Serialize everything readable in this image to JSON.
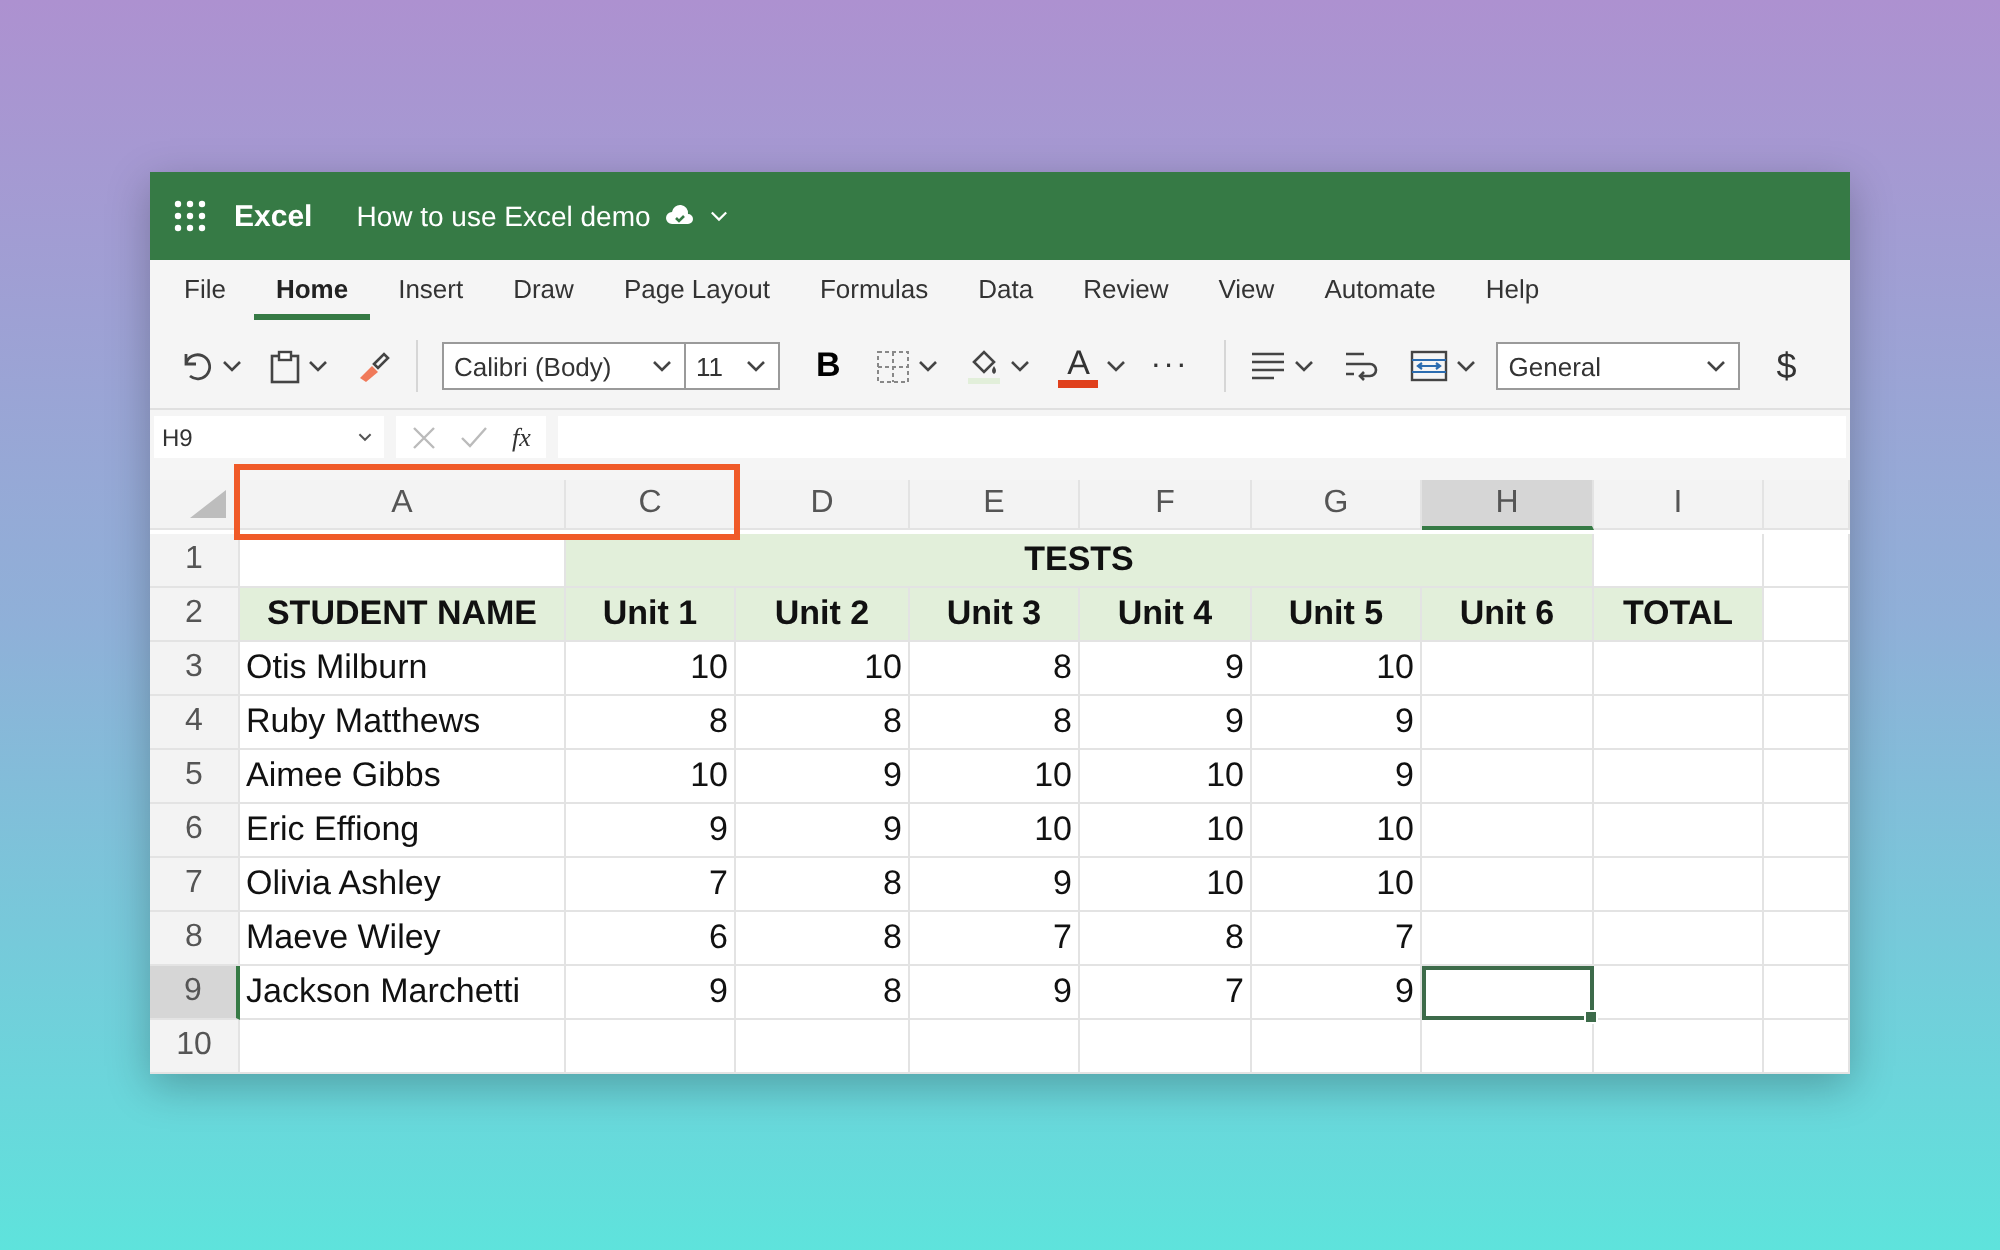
{
  "app": {
    "name": "Excel",
    "document_title": "How to use Excel demo"
  },
  "menu_tabs": [
    {
      "label": "File",
      "selected": false
    },
    {
      "label": "Home",
      "selected": true
    },
    {
      "label": "Insert",
      "selected": false
    },
    {
      "label": "Draw",
      "selected": false
    },
    {
      "label": "Page Layout",
      "selected": false
    },
    {
      "label": "Formulas",
      "selected": false
    },
    {
      "label": "Data",
      "selected": false
    },
    {
      "label": "Review",
      "selected": false
    },
    {
      "label": "View",
      "selected": false
    },
    {
      "label": "Automate",
      "selected": false
    },
    {
      "label": "Help",
      "selected": false
    }
  ],
  "toolbar": {
    "font": "Calibri (Body)",
    "font_size": "11",
    "bold": "B",
    "font_color": "A",
    "more": "···",
    "number_format": "General",
    "currency": "$"
  },
  "formula_bar": {
    "name_box": "H9",
    "function_label": "fx"
  },
  "sheet": {
    "columns": [
      {
        "label": "A",
        "selected": false,
        "highlighted": true
      },
      {
        "label": "C",
        "selected": false,
        "highlighted": true
      },
      {
        "label": "D",
        "selected": false,
        "highlighted": false
      },
      {
        "label": "E",
        "selected": false,
        "highlighted": false
      },
      {
        "label": "F",
        "selected": false,
        "highlighted": false
      },
      {
        "label": "G",
        "selected": false,
        "highlighted": false
      },
      {
        "label": "H",
        "selected": true,
        "highlighted": false
      },
      {
        "label": "I",
        "selected": false,
        "highlighted": false
      }
    ],
    "rows": [
      {
        "number": "1",
        "selected": false,
        "kind": "title",
        "title": "TESTS"
      },
      {
        "number": "2",
        "selected": false,
        "kind": "header",
        "cells": [
          "STUDENT NAME",
          "Unit 1",
          "Unit 2",
          "Unit 3",
          "Unit 4",
          "Unit 5",
          "Unit 6",
          "TOTAL"
        ]
      },
      {
        "number": "3",
        "selected": false,
        "kind": "data",
        "cells": [
          "Otis Milburn",
          "10",
          "10",
          "8",
          "9",
          "10"
        ]
      },
      {
        "number": "4",
        "selected": false,
        "kind": "data",
        "cells": [
          "Ruby Matthews",
          "8",
          "8",
          "8",
          "9",
          "9"
        ]
      },
      {
        "number": "5",
        "selected": false,
        "kind": "data",
        "cells": [
          "Aimee Gibbs",
          "10",
          "9",
          "10",
          "10",
          "9"
        ]
      },
      {
        "number": "6",
        "selected": false,
        "kind": "data",
        "cells": [
          "Eric Effiong",
          "9",
          "9",
          "10",
          "10",
          "10"
        ]
      },
      {
        "number": "7",
        "selected": false,
        "kind": "data",
        "cells": [
          "Olivia Ashley",
          "7",
          "8",
          "9",
          "10",
          "10"
        ]
      },
      {
        "number": "8",
        "selected": false,
        "kind": "data",
        "cells": [
          "Maeve Wiley",
          "6",
          "8",
          "7",
          "8",
          "7"
        ]
      },
      {
        "number": "9",
        "selected": true,
        "kind": "data",
        "cells": [
          "Jackson Marchetti",
          "9",
          "8",
          "9",
          "7",
          "9"
        ]
      },
      {
        "number": "10",
        "selected": false,
        "kind": "data",
        "cells": []
      }
    ]
  }
}
